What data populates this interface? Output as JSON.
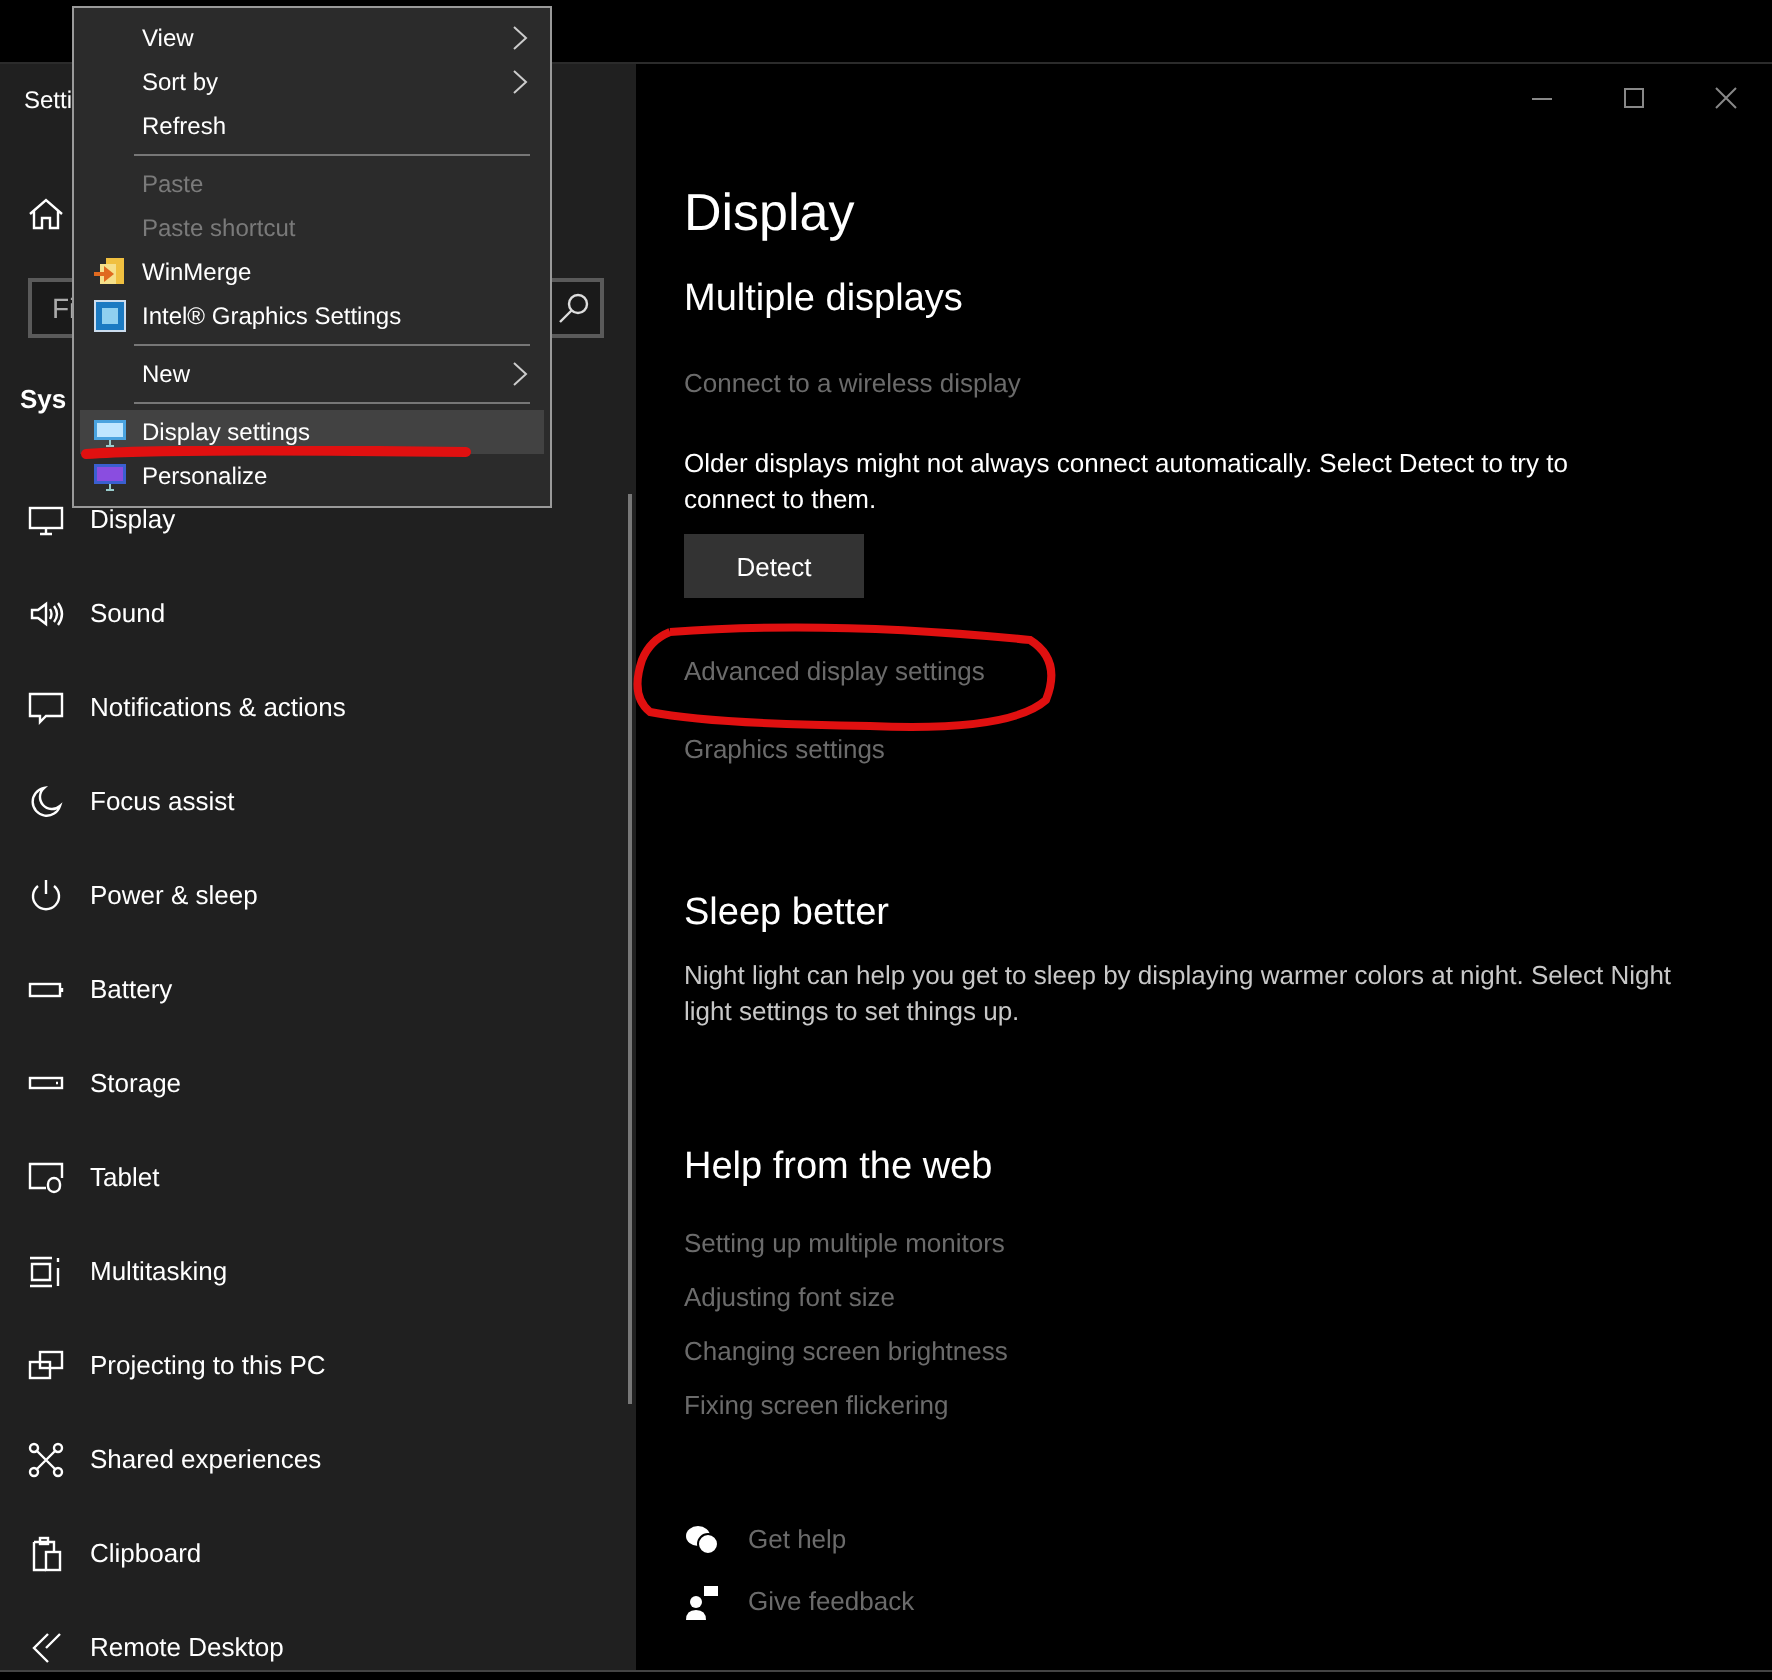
{
  "window": {
    "title": "Setti"
  },
  "sidebar": {
    "search": {
      "placeholder": "Fi"
    },
    "heading": "Sys",
    "items": [
      {
        "label": "Display",
        "selected": false
      },
      {
        "label": "Sound",
        "selected": false
      },
      {
        "label": "Notifications & actions",
        "selected": false
      },
      {
        "label": "Focus assist",
        "selected": false
      },
      {
        "label": "Power & sleep",
        "selected": false
      },
      {
        "label": "Battery",
        "selected": false
      },
      {
        "label": "Storage",
        "selected": false
      },
      {
        "label": "Tablet",
        "selected": false
      },
      {
        "label": "Multitasking",
        "selected": false
      },
      {
        "label": "Projecting to this PC",
        "selected": false
      },
      {
        "label": "Shared experiences",
        "selected": false
      },
      {
        "label": "Clipboard",
        "selected": false
      },
      {
        "label": "Remote Desktop",
        "selected": false
      }
    ]
  },
  "content": {
    "title": "Display",
    "sections": [
      {
        "heading": "Multiple displays",
        "blocks": [
          {
            "kind": "link",
            "text": "Connect to a wireless display"
          },
          {
            "kind": "text",
            "text": "Older displays might not always connect automatically. Select Detect to try to connect to them."
          },
          {
            "kind": "button",
            "text": "Detect"
          },
          {
            "kind": "link",
            "text": "Advanced display settings"
          },
          {
            "kind": "link",
            "text": "Graphics settings"
          }
        ]
      },
      {
        "heading": "Sleep better",
        "blocks": [
          {
            "kind": "text",
            "text": "Night light can help you get to sleep by displaying warmer colors at night. Select Night light settings to set things up."
          }
        ]
      },
      {
        "heading": "Help from the web",
        "blocks": [
          {
            "kind": "link",
            "text": "Setting up multiple monitors"
          },
          {
            "kind": "link",
            "text": "Adjusting font size"
          },
          {
            "kind": "link",
            "text": "Changing screen brightness"
          },
          {
            "kind": "link",
            "text": "Fixing screen flickering"
          }
        ]
      }
    ],
    "footer": [
      {
        "label": "Get help"
      },
      {
        "label": "Give feedback"
      }
    ]
  },
  "context_menu": {
    "items": [
      {
        "kind": "item",
        "label": "View",
        "submenu": true,
        "disabled": false,
        "selected": false
      },
      {
        "kind": "item",
        "label": "Sort by",
        "submenu": true,
        "disabled": false,
        "selected": false
      },
      {
        "kind": "item",
        "label": "Refresh",
        "submenu": false,
        "disabled": false,
        "selected": false
      },
      {
        "kind": "separator"
      },
      {
        "kind": "item",
        "label": "Paste",
        "submenu": false,
        "disabled": true,
        "selected": false
      },
      {
        "kind": "item",
        "label": "Paste shortcut",
        "submenu": false,
        "disabled": true,
        "selected": false
      },
      {
        "kind": "item",
        "label": "WinMerge",
        "submenu": false,
        "disabled": false,
        "selected": false
      },
      {
        "kind": "item",
        "label": "Intel® Graphics Settings",
        "submenu": false,
        "disabled": false,
        "selected": false
      },
      {
        "kind": "separator"
      },
      {
        "kind": "item",
        "label": "New",
        "submenu": true,
        "disabled": false,
        "selected": false
      },
      {
        "kind": "separator"
      },
      {
        "kind": "item",
        "label": "Display settings",
        "submenu": false,
        "disabled": false,
        "selected": true
      },
      {
        "kind": "item",
        "label": "Personalize",
        "submenu": false,
        "disabled": false,
        "selected": false
      }
    ]
  }
}
